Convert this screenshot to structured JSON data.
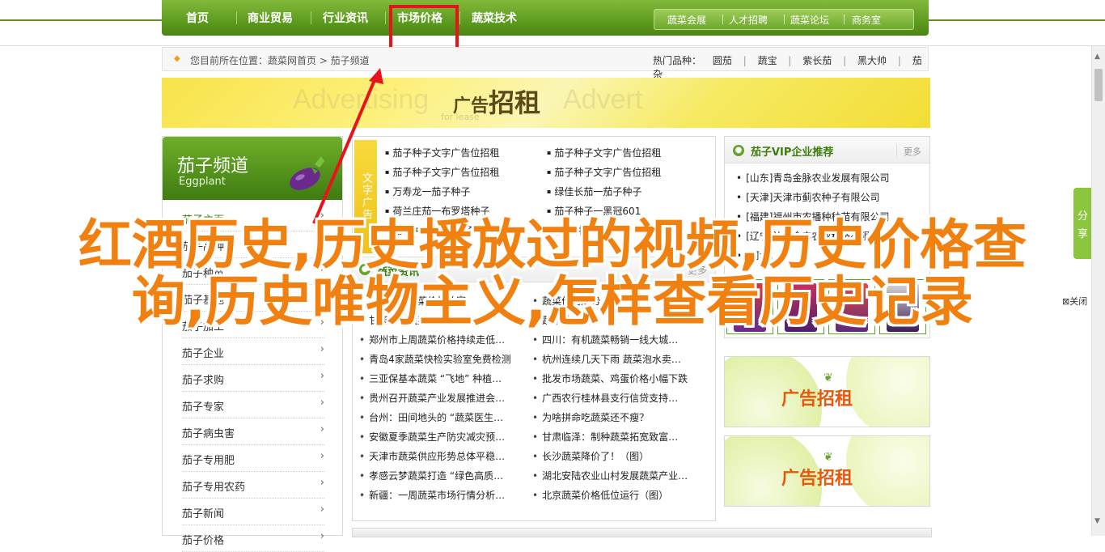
{
  "nav": {
    "items": [
      "首页",
      "商业贸易",
      "行业资讯",
      "市场价格",
      "蔬菜技术"
    ],
    "right_items": [
      "蔬菜会展",
      "人才招聘",
      "蔬菜论坛",
      "商务室"
    ]
  },
  "breadcrumb": {
    "text": "您目前所在位置：蔬菜网首页 > 茄子频道",
    "hot_label": "热门品种：",
    "hot_items": [
      "圆茄",
      "|",
      "蔬宝",
      "|",
      "紫长茄",
      "|",
      "黑大帅",
      "|",
      "茄杂"
    ]
  },
  "banner_top": {
    "ghost_left": "Advertising",
    "ghost_right": "Advert",
    "sub": "for lease",
    "main_small": "广告",
    "main_big": "招租"
  },
  "sidebar": {
    "title": "茄子频道",
    "subtitle": "Eggplant",
    "items": [
      "茄子主页",
      "茄子品种",
      "茄子种苗",
      "茄子基地",
      "茄子加工",
      "茄子企业",
      "茄子求购",
      "茄子专家",
      "茄子病虫害",
      "茄子专用肥",
      "茄子专用农药",
      "茄子新闻",
      "茄子价格"
    ],
    "arrow": "›"
  },
  "text_ads": {
    "label": "文字广告",
    "left": [
      "茄子种子文字广告位招租",
      "茄子种子文字广告位招租",
      "万寿龙一茄子种子",
      "荷兰庄茄一布罗塔种子",
      "茄子种子 茄子种子"
    ],
    "right": [
      "茄子种子文字广告位招租",
      "茄子种子文字广告位招租",
      "绿佳长茄一茄子种子",
      "茄子种子一黑冠601",
      "茄子种子"
    ]
  },
  "news": {
    "title": "蔬菜资讯",
    "more": "更多",
    "left": [
      "山东济南蔬菜价格致富",
      "甘肃酒泉蔬菜产业发展",
      "郑州市上周蔬菜价格持续走低…",
      "青岛4家蔬菜快检实验室免费检测",
      "三亚保基本蔬菜 “飞地” 种植…",
      "贵州召开蔬菜产业发展推进会…",
      "台州：田间地头的 “蔬菜医生…",
      "安徽夏季蔬菜生产防灾减灾预…",
      "天津市蔬菜供应形势总体平稳…",
      "孝感云梦蔬菜打造 “绿色高质…",
      "新疆：一周蔬菜市场行情分析…"
    ],
    "right": [
      "蔬菜价格走势",
      "蔬菜种植技术",
      "四川：有机蔬菜畅销一线大城…",
      "杭州连续几天下雨  蔬菜泡水卖…",
      "批发市场蔬菜、鸡蛋价格小幅下跌",
      "广西农行桂林县支行信贷支持…",
      "为啥拼命吃蔬菜还不瘦？",
      "甘肃临泽：制种蔬菜拓宽致富…",
      "长沙蔬菜降价了！（图）",
      "湖北安陆农业山村发展蔬菜产业…",
      "北京蔬菜价格低位运行（图）"
    ]
  },
  "vip": {
    "title": "茄子VIP企业推荐",
    "more": "更多",
    "items": [
      "[山东]青岛金脉农业发展有限公司",
      "[天津]天津市蓟农种子有限公司",
      "[福建]福州市农播种种苗有限公司",
      "[辽宁]沈阳金丰农业科技有限公司",
      "[河北]…"
    ]
  },
  "ads_right": {
    "small": "广告",
    "big": "招租"
  },
  "share": {
    "label_1": "分",
    "label_2": "享",
    "close": "关闭",
    "close_icon": "close-icon"
  },
  "overlay": {
    "line1": "红酒历史,历史播放过的视频,历史价格查",
    "line2": "询,历史唯物主义,怎样查看历史记录"
  },
  "colors": {
    "brand_green": "#5d9b1f",
    "overlay_orange": "#f08010",
    "highlight_red": "#e8141c"
  }
}
